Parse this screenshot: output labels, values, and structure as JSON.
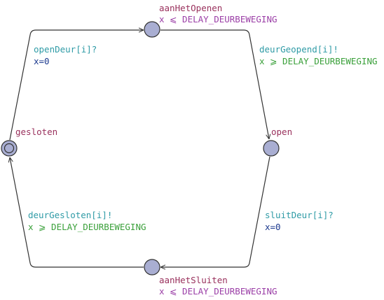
{
  "colors": {
    "background": "#ffffff",
    "state_fill": "#a9aed2",
    "state_stroke": "#333333",
    "edge": "#333333",
    "location_name": "#99305c",
    "invariant": "#9b3fa7",
    "sync": "#2f9ba6",
    "guard": "#3aa03a",
    "assignment": "#1d3a8f"
  },
  "states": {
    "gesloten": {
      "name": "gesloten",
      "initial": true
    },
    "aanHetOpenen": {
      "name": "aanHetOpenen",
      "invariant": "x ⩽ DELAY_DEURBEWEGING"
    },
    "open": {
      "name": "open"
    },
    "aanHetSluiten": {
      "name": "aanHetSluiten",
      "invariant": "x ⩽ DELAY_DEURBEWEGING"
    }
  },
  "transitions": {
    "gesloten_to_aanHetOpenen": {
      "sync": "openDeur[i]?",
      "update": "x=0"
    },
    "aanHetOpenen_to_open": {
      "sync": "deurGeopend[i]!",
      "guard": "x ⩾ DELAY_DEURBEWEGING"
    },
    "open_to_aanHetSluiten": {
      "sync": "sluitDeur[i]?",
      "update": "x=0"
    },
    "aanHetSluiten_to_gesloten": {
      "sync": "deurGesloten[i]!",
      "guard": "x ⩾ DELAY_DEURBEWEGING"
    }
  }
}
